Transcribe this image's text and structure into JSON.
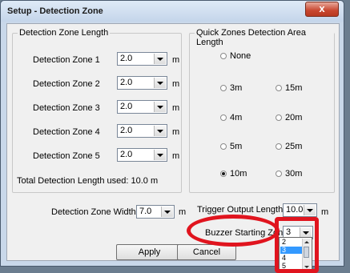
{
  "window": {
    "title": "Setup - Detection Zone",
    "close_glyph": "x"
  },
  "detection": {
    "legend": "Detection Zone Length",
    "zones": [
      {
        "label": "Detection Zone 1",
        "value": "2.0",
        "unit": "m"
      },
      {
        "label": "Detection Zone 2",
        "value": "2.0",
        "unit": "m"
      },
      {
        "label": "Detection Zone 3",
        "value": "2.0",
        "unit": "m"
      },
      {
        "label": "Detection Zone 4",
        "value": "2.0",
        "unit": "m"
      },
      {
        "label": "Detection Zone 5",
        "value": "2.0",
        "unit": "m"
      }
    ],
    "total": "Total Detection Length used: 10.0 m"
  },
  "quick": {
    "legend": "Quick Zones Detection Area Length",
    "options": [
      "None",
      "3m",
      "15m",
      "4m",
      "20m",
      "5m",
      "25m",
      "10m",
      "30m"
    ],
    "selected": "10m"
  },
  "bottom": {
    "width_label": "Detection Zone Width:",
    "width_value": "7.0",
    "width_unit": "m",
    "trigger_label": "Trigger Output Length:",
    "trigger_value": "10.0",
    "trigger_unit": "m",
    "buzzer_label": "Buzzer Starting Zone",
    "buzzer_value": "3",
    "buzzer_options": [
      "2",
      "3",
      "4",
      "5"
    ],
    "buzzer_selected": "3"
  },
  "buttons": {
    "apply": "Apply",
    "cancel": "Cancel"
  },
  "annotation_color": "#e0141e"
}
